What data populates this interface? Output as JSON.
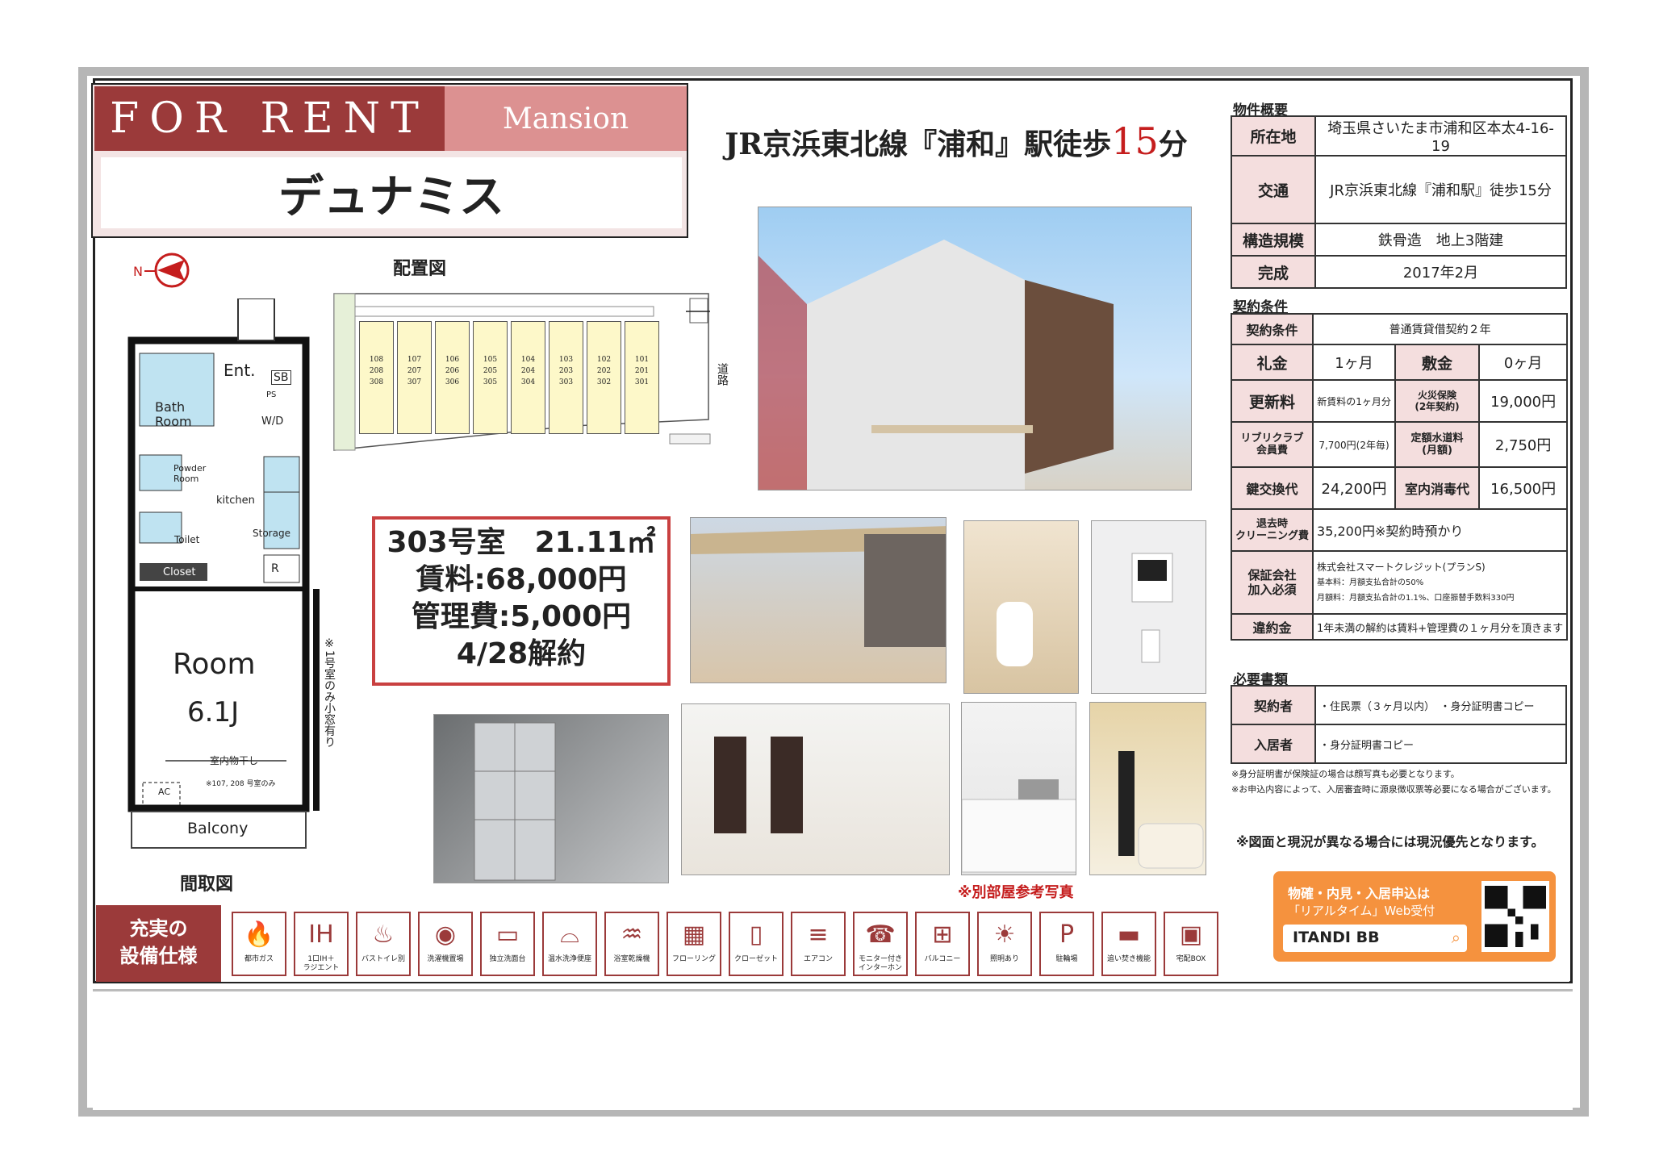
{
  "header": {
    "for_rent": "FOR RENT",
    "mansion": "Mansion",
    "property_name": "デュナミス"
  },
  "station": {
    "prefix": "JR京浜東北線『浦和』駅徒歩",
    "minutes": "15",
    "suffix": "分"
  },
  "layout_label": "配置図",
  "layout_rooms": [
    {
      "top": "108",
      "mid": "208",
      "bot": "308"
    },
    {
      "top": "107",
      "mid": "207",
      "bot": "307"
    },
    {
      "top": "106",
      "mid": "206",
      "bot": "306"
    },
    {
      "top": "105",
      "mid": "205",
      "bot": "305"
    },
    {
      "top": "104",
      "mid": "204",
      "bot": "304"
    },
    {
      "top": "103",
      "mid": "203",
      "bot": "303"
    },
    {
      "top": "102",
      "mid": "202",
      "bot": "302"
    },
    {
      "top": "101",
      "mid": "201",
      "bot": "301"
    }
  ],
  "road_label": "道路",
  "floorplan": {
    "ent": "Ent.",
    "sb": "SB",
    "ps": "PS",
    "bath": "Bath\nRoom",
    "wd": "W/D",
    "powder": "Powder\nRoom",
    "kitchen": "kitchen",
    "toilet": "Toilet",
    "storage": "Storage",
    "closet": "Closet",
    "r": "R",
    "room": "Room",
    "room_size": "6.1J",
    "indoor_dry": "室内物干し",
    "note_small": "※107, 208 号室のみ",
    "ac": "AC",
    "balcony": "Balcony",
    "side_note": "※1号室のみ小窓有り",
    "title": "間取図"
  },
  "unit": {
    "line1": "303号室　21.11㎡",
    "line2": "賃料:68,000円",
    "line3": "管理費:5,000円",
    "line4": "4/28解約"
  },
  "photo_note": "※別部屋参考写真",
  "overview": {
    "title": "物件概要",
    "rows": [
      {
        "label": "所在地",
        "value": "埼玉県さいたま市浦和区本太4-16-19"
      },
      {
        "label": "交通",
        "value": "JR京浜東北線『浦和駅』徒歩15分"
      },
      {
        "label": "構造規模",
        "value": "鉄骨造　地上3階建"
      },
      {
        "label": "完成",
        "value": "2017年2月"
      }
    ]
  },
  "contract": {
    "title": "契約条件",
    "type_label": "契約条件",
    "type_value": "普通賃貸借契約２年",
    "reikin_label": "礼金",
    "reikin_value": "1ヶ月",
    "shikikin_label": "敷金",
    "shikikin_value": "0ヶ月",
    "renewal_label": "更新料",
    "renewal_value": "新賃料の1ヶ月分",
    "fire_label": "火災保険\n(2年契約)",
    "fire_value": "19,000円",
    "club_label": "リブリクラブ\n会員費",
    "club_value": "7,700円(2年毎)",
    "water_label": "定額水道料\n(月額)",
    "water_value": "2,750円",
    "key_label": "鍵交換代",
    "key_value": "24,200円",
    "disinfect_label": "室内消毒代",
    "disinfect_value": "16,500円",
    "cleaning_label": "退去時\nクリーニング費",
    "cleaning_value": "35,200円※契約時預かり",
    "guarantor_label": "保証会社\n加入必須",
    "guarantor_value1": "株式会社スマートクレジット(プランS)",
    "guarantor_value2": "基本料：月額支払合計の50%",
    "guarantor_value3": "月額料：月額支払合計の1.1%、口座振替手数料330円",
    "penalty_label": "違約金",
    "penalty_value": "1年未満の解約は賃料+管理費の１ヶ月分を頂きます"
  },
  "docs": {
    "title": "必要書類",
    "contractor_label": "契約者",
    "contractor_value": "・住民票（３ヶ月以内）　・身分証明書コピー",
    "resident_label": "入居者",
    "resident_value": "・身分証明書コピー",
    "note1": "※身分証明書が保険証の場合は顔写真も必要となります。",
    "note2": "※お申込内容によって、入居審査時に源泉徴収票等必要になる場合がございます。"
  },
  "priority_note": "※図面と現況が異なる場合には現況優先となります。",
  "amenities": {
    "title": "充実の\n設備仕様",
    "items": [
      {
        "icon": "gas-icon",
        "glyph": "🔥",
        "label": "都市ガス"
      },
      {
        "icon": "ih-icon",
        "glyph": "IH",
        "label": "1口IH＋\nラジエント"
      },
      {
        "icon": "bath-toilet-icon",
        "glyph": "♨",
        "label": "バストイレ別"
      },
      {
        "icon": "washer-icon",
        "glyph": "◉",
        "label": "洗濯機置場"
      },
      {
        "icon": "sink-icon",
        "glyph": "▭",
        "label": "独立洗面台"
      },
      {
        "icon": "washlet-icon",
        "glyph": "⌓",
        "label": "温水洗浄便座"
      },
      {
        "icon": "dryer-icon",
        "glyph": "♒",
        "label": "浴室乾燥機"
      },
      {
        "icon": "flooring-icon",
        "glyph": "▦",
        "label": "フローリング"
      },
      {
        "icon": "closet-icon",
        "glyph": "▯",
        "label": "クローゼット"
      },
      {
        "icon": "aircon-icon",
        "glyph": "≡",
        "label": "エアコン"
      },
      {
        "icon": "intercom-icon",
        "glyph": "☎",
        "label": "モニター付き\nインターホン"
      },
      {
        "icon": "balcony-icon",
        "glyph": "⊞",
        "label": "バルコニー"
      },
      {
        "icon": "lighting-icon",
        "glyph": "☀",
        "label": "照明あり"
      },
      {
        "icon": "bicycle-icon",
        "glyph": "P",
        "label": "駐輪場"
      },
      {
        "icon": "laundry-icon",
        "glyph": "▬",
        "label": "追い焚き機能"
      },
      {
        "icon": "delivery-box-icon",
        "glyph": "▣",
        "label": "宅配BOX"
      }
    ]
  },
  "itandi": {
    "line1": "物確・内見・入居申込は",
    "line2": "「リアルタイム」Web受付",
    "brand": "ITANDI BB"
  }
}
